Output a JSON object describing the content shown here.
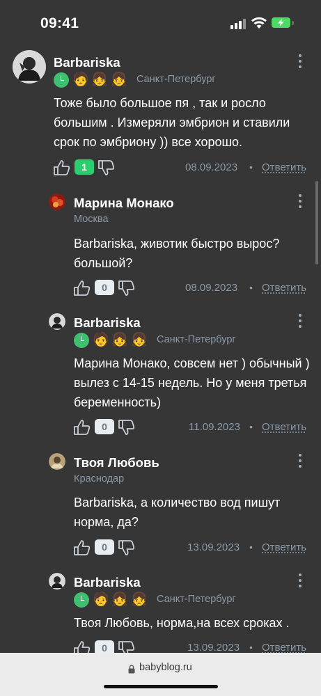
{
  "status_bar": {
    "time": "09:41"
  },
  "comments": [
    {
      "author": "Barbariska",
      "city": "Санкт-Петербург",
      "emojis": [
        "🧑",
        "👧",
        "👧"
      ],
      "text": "Тоже было большое пя , так и росло большим . Измеряли эмбрион и ставили срок по эмбриону )) все хорошо.",
      "likes": "1",
      "date": "08.09.2023",
      "reply": "Ответить"
    },
    {
      "author": "Марина Монако",
      "city": "Москва",
      "text": "Barbariska, животик быстро вырос? большой?",
      "likes": "0",
      "date": "08.09.2023",
      "reply": "Ответить"
    },
    {
      "author": "Barbariska",
      "city": "Санкт-Петербург",
      "emojis": [
        "🧑",
        "👧",
        "👧"
      ],
      "text": "Марина Монако, совсем нет ) обычный ) вылез с 14-15 недель. Но у меня третья беременность)",
      "likes": "0",
      "date": "11.09.2023",
      "reply": "Ответить"
    },
    {
      "author": "Твоя Любовь",
      "city": "Краснодар",
      "text": "Barbariska, а количество вод пишут норма, да?",
      "likes": "0",
      "date": "13.09.2023",
      "reply": "Ответить"
    },
    {
      "author": "Barbariska",
      "city": "Санкт-Петербург",
      "emojis": [
        "🧑",
        "👧",
        "👧"
      ],
      "text": "Твоя Любовь, норма,на всех сроках .",
      "likes": "0",
      "date": "13.09.2023",
      "reply": "Ответить"
    }
  ],
  "separator": "•",
  "browser": {
    "url": "babyblog.ru"
  },
  "colors": {
    "background": "#363636",
    "positive": "#2ecc71",
    "muted": "#8b9aa8",
    "accent_green": "#3fbf6f"
  }
}
